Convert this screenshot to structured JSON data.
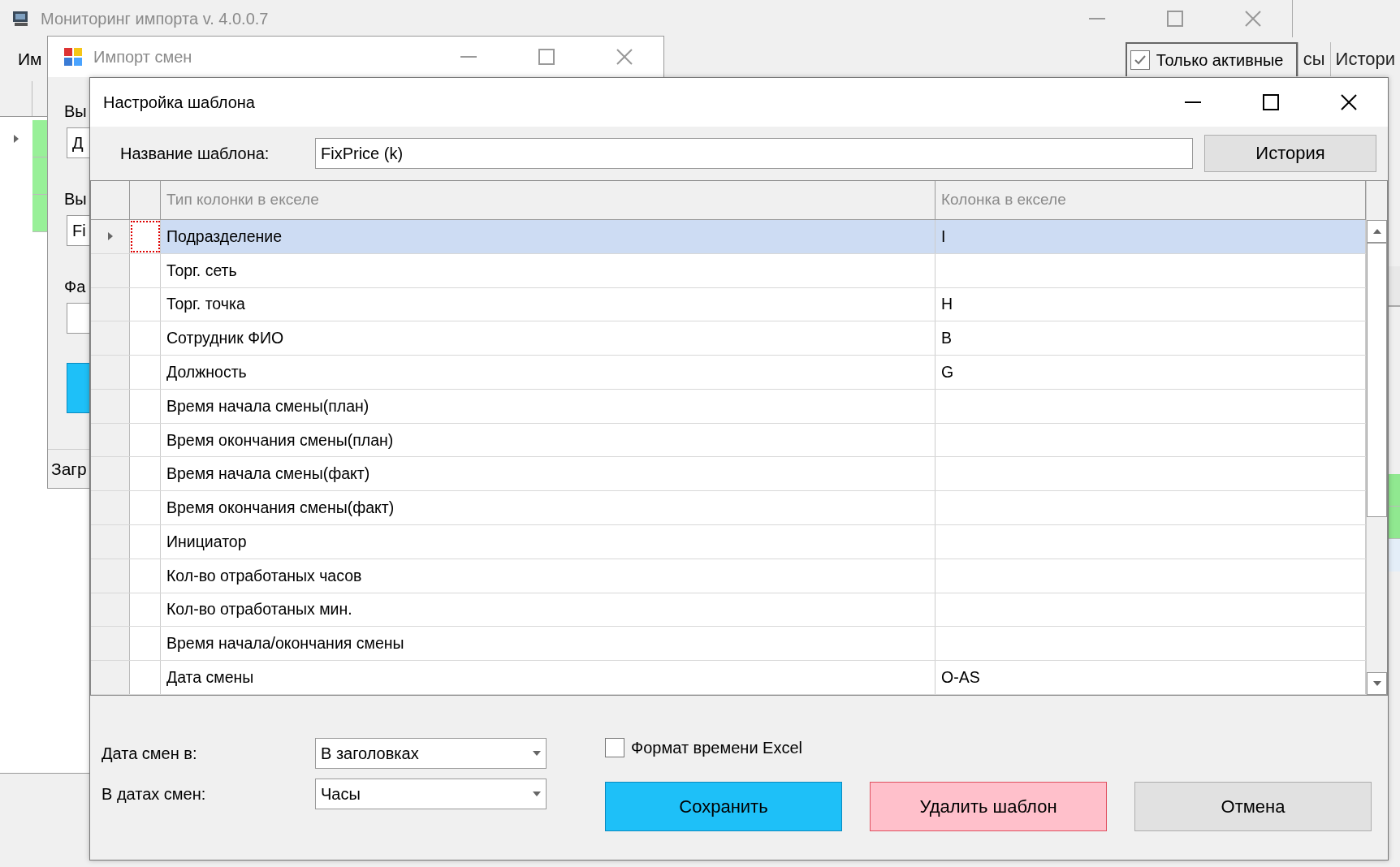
{
  "main_window": {
    "title": "Мониторинг импорта v. 4.0.0.7",
    "menu": [
      "Им"
    ],
    "only_active": {
      "label": "Только активные",
      "checked": true
    },
    "tabs": [
      {
        "label": "сы",
        "selected": false
      },
      {
        "label": "Истори",
        "selected": false
      }
    ],
    "grid_rows": [
      {
        "current": true
      },
      {
        "current": false
      },
      {
        "current": false
      }
    ]
  },
  "import_window": {
    "title": "Импорт смен",
    "items": [
      {
        "kind": "label",
        "text": "Вы"
      },
      {
        "kind": "field",
        "text": "Д"
      },
      {
        "kind": "label",
        "text": "Вы"
      },
      {
        "kind": "field",
        "text": "Fi"
      },
      {
        "kind": "label",
        "text": "Фа"
      },
      {
        "kind": "field"
      },
      {
        "kind": "button"
      }
    ],
    "status": "Загр"
  },
  "dialog": {
    "title": "Настройка шаблона",
    "name_label": "Название шаблона:",
    "name_value": "FixPrice (k)",
    "history_button": "История",
    "columns": [
      "Тип колонки в екселе",
      "Колонка в екселе"
    ],
    "rows": [
      {
        "type": "Подразделение",
        "column": "I",
        "selected": true
      },
      {
        "type": "Торг. сеть",
        "selected": false
      },
      {
        "type": "Торг. точка",
        "column": "H",
        "selected": false
      },
      {
        "type": "Сотрудник ФИО",
        "column": "B",
        "selected": false
      },
      {
        "type": "Должность",
        "column": "G",
        "selected": false
      },
      {
        "type": "Время начала смены(план)",
        "selected": false
      },
      {
        "type": "Время окончания смены(план)",
        "selected": false
      },
      {
        "type": "Время начала смены(факт)",
        "selected": false
      },
      {
        "type": "Время окончания смены(факт)",
        "selected": false
      },
      {
        "type": "Инициатор",
        "selected": false
      },
      {
        "type": "Кол-во отработаных часов",
        "selected": false
      },
      {
        "type": "Кол-во отработаных мин.",
        "selected": false
      },
      {
        "type": "Время начала/окончания смены",
        "selected": false
      },
      {
        "type": "Дата смены",
        "column": "O-AS",
        "selected": false
      }
    ],
    "date_in": {
      "label": "Дата смен в:",
      "value": "В заголовках"
    },
    "in_dates": {
      "label": "В датах смен:",
      "value": "Часы"
    },
    "excel_time": {
      "label": "Формат времени Excel",
      "checked": false
    },
    "buttons": [
      {
        "label": "Сохранить",
        "kind": "primary"
      },
      {
        "label": "Удалить шаблон",
        "kind": "danger"
      },
      {
        "label": "Отмена",
        "kind": "default"
      }
    ]
  }
}
